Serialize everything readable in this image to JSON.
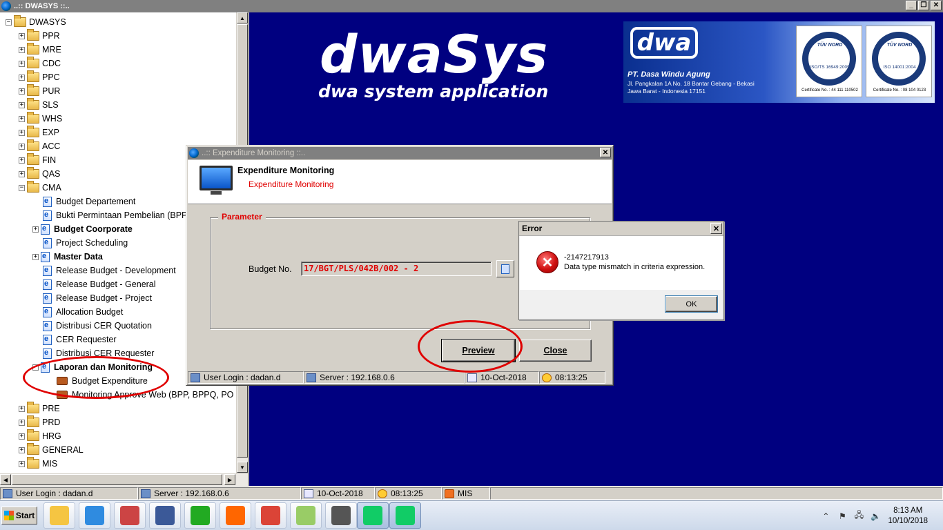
{
  "window": {
    "title": "..:: DWASYS ::..",
    "min": "_",
    "max": "❐",
    "close": "✕"
  },
  "tree": {
    "root": "DWASYS",
    "items": [
      {
        "label": "PPR",
        "type": "folder",
        "level": 1,
        "expand": "+"
      },
      {
        "label": "MRE",
        "type": "folder",
        "level": 1,
        "expand": "+"
      },
      {
        "label": "CDC",
        "type": "folder",
        "level": 1,
        "expand": "+"
      },
      {
        "label": "PPC",
        "type": "folder",
        "level": 1,
        "expand": "+"
      },
      {
        "label": "PUR",
        "type": "folder",
        "level": 1,
        "expand": "+"
      },
      {
        "label": "SLS",
        "type": "folder",
        "level": 1,
        "expand": "+"
      },
      {
        "label": "WHS",
        "type": "folder",
        "level": 1,
        "expand": "+"
      },
      {
        "label": "EXP",
        "type": "folder",
        "level": 1,
        "expand": "+"
      },
      {
        "label": "ACC",
        "type": "folder",
        "level": 1,
        "expand": "+"
      },
      {
        "label": "FIN",
        "type": "folder",
        "level": 1,
        "expand": "+"
      },
      {
        "label": "QAS",
        "type": "folder",
        "level": 1,
        "expand": "+"
      },
      {
        "label": "CMA",
        "type": "folder",
        "level": 1,
        "expand": "−"
      },
      {
        "label": "Budget Departement",
        "type": "doc",
        "level": 2
      },
      {
        "label": "Bukti Permintaan Pembelian (BPP)",
        "type": "doc",
        "level": 2
      },
      {
        "label": "Budget Coorporate",
        "type": "doc",
        "level": 2,
        "expand": "+",
        "bold": true
      },
      {
        "label": "Project Scheduling",
        "type": "doc",
        "level": 2
      },
      {
        "label": "Master Data",
        "type": "doc",
        "level": 2,
        "expand": "+",
        "bold": true
      },
      {
        "label": "Release Budget - Development",
        "type": "doc",
        "level": 2
      },
      {
        "label": "Release Budget - General",
        "type": "doc",
        "level": 2
      },
      {
        "label": "Release Budget - Project",
        "type": "doc",
        "level": 2
      },
      {
        "label": "Allocation Budget",
        "type": "doc",
        "level": 2
      },
      {
        "label": "Distribusi CER Quotation",
        "type": "doc",
        "level": 2
      },
      {
        "label": "CER Requester",
        "type": "doc",
        "level": 2
      },
      {
        "label": "Distribusi CER Requester",
        "type": "doc",
        "level": 2
      },
      {
        "label": "Laporan dan Monitoring",
        "type": "doc",
        "level": 2,
        "expand": "−",
        "bold": true
      },
      {
        "label": "Budget Expenditure",
        "type": "brief",
        "level": 3
      },
      {
        "label": "Monitoring Approve Web (BPP, BPPQ, PO BPP)",
        "type": "brief",
        "level": 3
      },
      {
        "label": "PRE",
        "type": "folder",
        "level": 1,
        "expand": "+"
      },
      {
        "label": "PRD",
        "type": "folder",
        "level": 1,
        "expand": "+"
      },
      {
        "label": "HRG",
        "type": "folder",
        "level": 1,
        "expand": "+"
      },
      {
        "label": "GENERAL",
        "type": "folder",
        "level": 1,
        "expand": "+"
      },
      {
        "label": "MIS",
        "type": "folder",
        "level": 1,
        "expand": "+"
      }
    ]
  },
  "brand": {
    "logo": "dwaSys",
    "tagline": "dwa system application",
    "banner_logo": "dwa",
    "company": "PT. Dasa Windu Agung",
    "address1": "Jl. Pangkalan 1A No. 18 Bantar Gebang - Bekasi",
    "address2": "Jawa Barat - Indonesia 17151",
    "cert1": {
      "name": "TÜV NORD",
      "std": "ISO/TS 16949:2009",
      "no": "Certificate No. : 44 111 110502"
    },
    "cert2": {
      "name": "TÜV NORD",
      "std": "ISO 14001:2004",
      "no": "Certificate No. : 08 104 0123"
    }
  },
  "dialog": {
    "title": "..:: Expenditure Monitoring ::..",
    "close": "✕",
    "heading": "Expenditure Monitoring",
    "subheading": "Expenditure Monitoring",
    "group_label": "Parameter",
    "budget_label": "Budget No.",
    "budget_value": "17/BGT/PLS/042B/002 - 2",
    "preview": "Preview",
    "close_btn": "Close",
    "status": {
      "user": "User Login : dadan.d",
      "server": "Server : 192.168.0.6",
      "date": "10-Oct-2018",
      "time": "08:13:25"
    }
  },
  "error": {
    "title": "Error",
    "close": "✕",
    "icon": "✕",
    "code": "-2147217913",
    "message": "Data type mismatch in criteria expression.",
    "ok": "OK"
  },
  "appstatus": {
    "user": "User Login : dadan.d",
    "server": "Server : 192.168.0.6",
    "date": "10-Oct-2018",
    "time": "08:13:25",
    "dept": "MIS"
  },
  "taskbar": {
    "start": "Start",
    "apps": [
      "file-explorer-icon",
      "media-player-icon",
      "snipping-tool-icon",
      "remote-desktop-icon",
      "eye-viewer-icon",
      "firefox-icon",
      "chrome-icon",
      "sticky-notes-icon",
      "dos-32-icon",
      "dwasys-globe-icon",
      "dwasys-globe-icon-2"
    ],
    "time": "8:13 AM",
    "date": "10/10/2018"
  }
}
